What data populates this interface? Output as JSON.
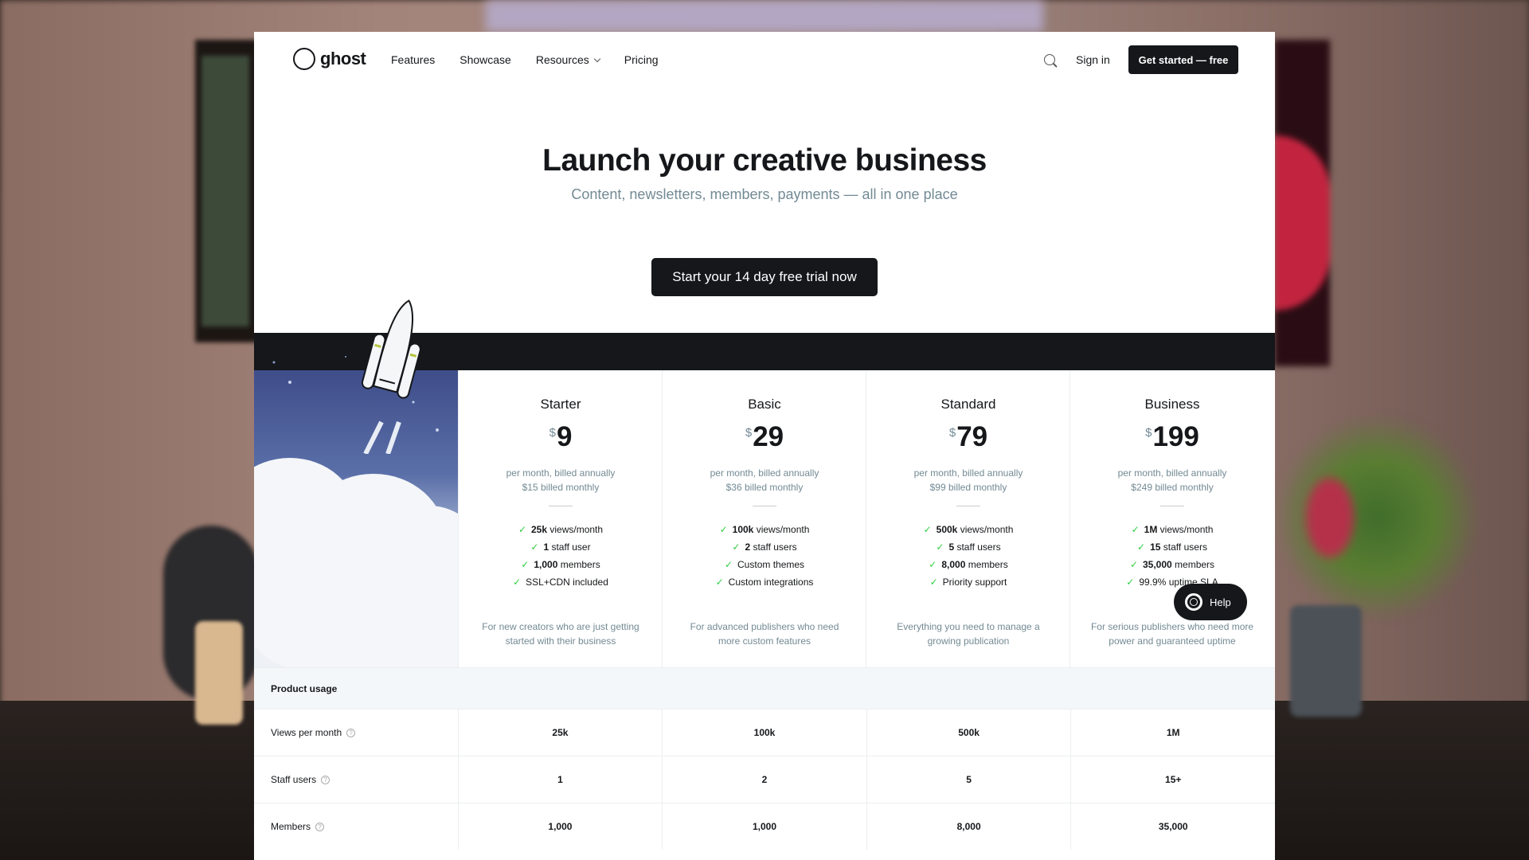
{
  "brand": {
    "name": "ghost"
  },
  "nav": {
    "links": [
      "Features",
      "Showcase",
      "Resources",
      "Pricing"
    ],
    "sign_in": "Sign in",
    "cta": "Get started — free"
  },
  "hero": {
    "title": "Launch your creative business",
    "subtitle": "Content, newsletters, members, payments — all in one place",
    "cta": "Start your 14 day free trial now"
  },
  "plans": [
    {
      "name": "Starter",
      "currency": "$",
      "price": "9",
      "billing_annual": "per month, billed annually",
      "billing_monthly": "$15 billed monthly",
      "features": [
        {
          "bold": "25k",
          "text": " views/month"
        },
        {
          "bold": "1",
          "text": " staff user"
        },
        {
          "bold": "1,000",
          "text": " members"
        },
        {
          "bold": "",
          "text": "SSL+CDN included"
        }
      ],
      "description": "For new creators who are just getting started with their business"
    },
    {
      "name": "Basic",
      "currency": "$",
      "price": "29",
      "billing_annual": "per month, billed annually",
      "billing_monthly": "$36 billed monthly",
      "features": [
        {
          "bold": "100k",
          "text": " views/month"
        },
        {
          "bold": "2",
          "text": " staff users"
        },
        {
          "bold": "",
          "text": "Custom themes"
        },
        {
          "bold": "",
          "text": "Custom integrations"
        }
      ],
      "description": "For advanced publishers who need more custom features"
    },
    {
      "name": "Standard",
      "currency": "$",
      "price": "79",
      "billing_annual": "per month, billed annually",
      "billing_monthly": "$99 billed monthly",
      "features": [
        {
          "bold": "500k",
          "text": " views/month"
        },
        {
          "bold": "5",
          "text": " staff users"
        },
        {
          "bold": "8,000",
          "text": " members"
        },
        {
          "bold": "",
          "text": "Priority support"
        }
      ],
      "description": "Everything you need to manage a growing publication"
    },
    {
      "name": "Business",
      "currency": "$",
      "price": "199",
      "billing_annual": "per month, billed annually",
      "billing_monthly": "$249 billed monthly",
      "features": [
        {
          "bold": "1M",
          "text": " views/month"
        },
        {
          "bold": "15",
          "text": " staff users"
        },
        {
          "bold": "35,000",
          "text": " members"
        },
        {
          "bold": "",
          "text": "99.9% uptime SLA"
        }
      ],
      "description": "For serious publishers who need more power and guaranteed uptime"
    }
  ],
  "help": {
    "label": "Help"
  },
  "table": {
    "section": "Product usage",
    "rows": [
      {
        "label": "Views per month",
        "values": [
          "25k",
          "100k",
          "500k",
          "1M"
        ]
      },
      {
        "label": "Staff users",
        "values": [
          "1",
          "2",
          "5",
          "15+"
        ]
      },
      {
        "label": "Members",
        "values": [
          "1,000",
          "1,000",
          "8,000",
          "35,000"
        ]
      }
    ]
  },
  "colors": {
    "dark": "#15171a",
    "muted": "#738a94",
    "check": "#30cf43"
  }
}
